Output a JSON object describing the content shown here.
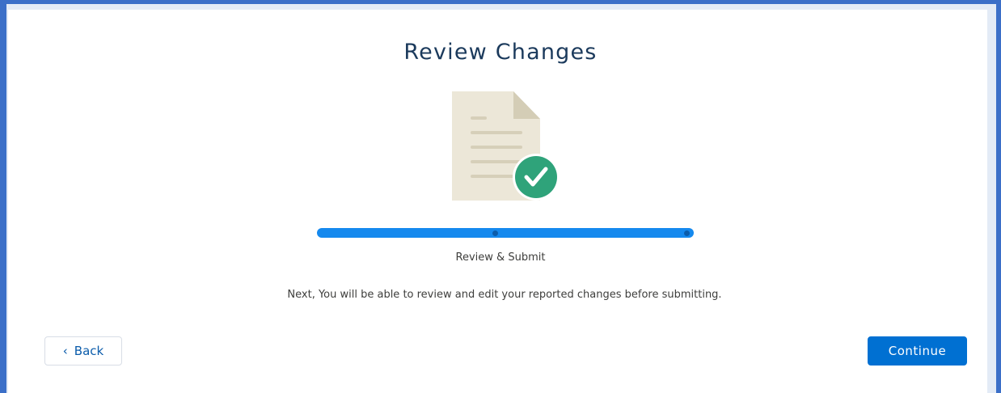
{
  "page": {
    "title": "Review Changes",
    "illustration_icon": "document-check-icon"
  },
  "progress": {
    "step_label": "Review & Submit",
    "steps_total": 3,
    "current_step": 3,
    "fill_fraction": 1.0,
    "bar_color": "#1589ee"
  },
  "message": "Next, You will be able to review and edit your reported changes before submitting.",
  "buttons": {
    "back_icon": "chevron-left-icon",
    "back_glyph": "‹",
    "back_label": "Back",
    "continue_label": "Continue",
    "continue_color": "#0070d2"
  }
}
